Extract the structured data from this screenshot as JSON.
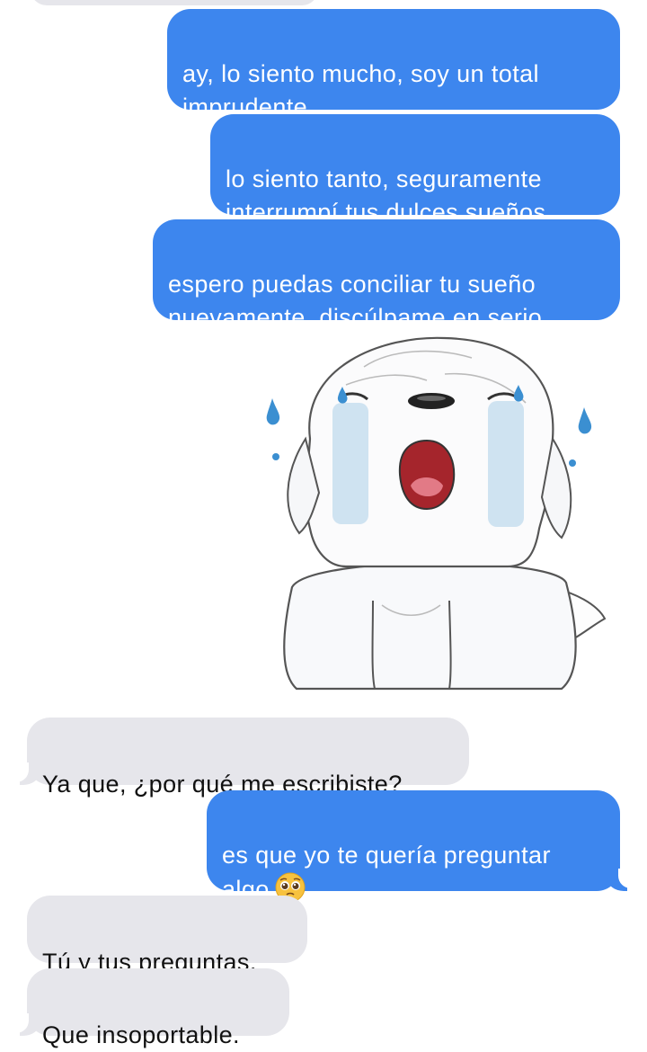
{
  "conversation": {
    "messages": [
      {
        "side": "sent",
        "text": "ay, lo siento mucho, soy un total\nimprudente"
      },
      {
        "side": "sent",
        "text": "lo siento tanto, seguramente\ninterrumpí tus dulces sueños"
      },
      {
        "side": "sent",
        "text": "espero puedas conciliar tu sueño\nnuevamente, discúlpame en serio"
      },
      {
        "side": "sticker",
        "icon": "crying-white-dog-sticker"
      },
      {
        "side": "received",
        "text": "Ya que, ¿por qué me escribiste?"
      },
      {
        "side": "sent",
        "text": "es que yo te quería preguntar\nalgo",
        "emoji": "pleading-face-emoji"
      },
      {
        "side": "received",
        "text": "Tú y tus preguntas."
      },
      {
        "side": "received",
        "text": "Que insoportable."
      }
    ]
  },
  "colors": {
    "sent_bubble": "#3d86ee",
    "received_bubble": "#e6e6eb",
    "background": "#ffffff"
  }
}
